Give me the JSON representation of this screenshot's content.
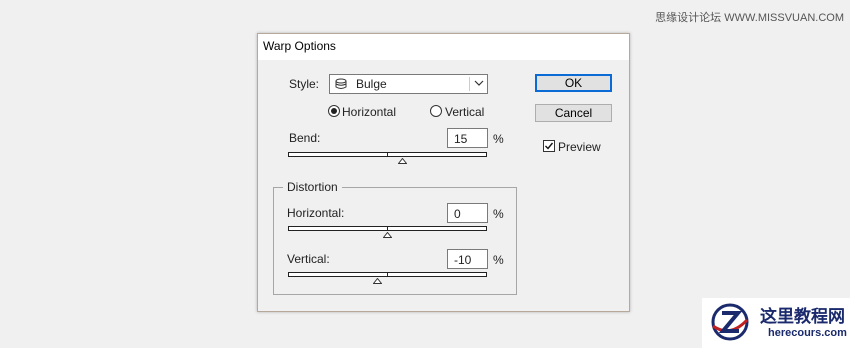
{
  "watermark": {
    "top_text": "思缘设计论坛 WWW.MISSVUAN.COM",
    "logo_cn": "这里教程网",
    "logo_url": "herecours.com"
  },
  "dialog": {
    "title": "Warp Options",
    "style": {
      "label": "Style:",
      "value": "Bulge",
      "icon": "bulge-icon"
    },
    "orientation": {
      "horizontal_label": "Horizontal",
      "vertical_label": "Vertical",
      "selected": "Horizontal"
    },
    "bend": {
      "label": "Bend:",
      "value": "15",
      "unit": "%",
      "slider_value": 15,
      "range": [
        -100,
        100
      ]
    },
    "distortion": {
      "title": "Distortion",
      "horizontal": {
        "label": "Horizontal:",
        "value": "0",
        "unit": "%",
        "slider_value": 0,
        "range": [
          -100,
          100
        ]
      },
      "vertical": {
        "label": "Vertical:",
        "value": "-10",
        "unit": "%",
        "slider_value": -10,
        "range": [
          -100,
          100
        ]
      }
    },
    "buttons": {
      "ok": "OK",
      "cancel": "Cancel"
    },
    "preview": {
      "label": "Preview",
      "checked": true
    },
    "colors": {
      "accent": "#0a6ad6",
      "border": "#b7a89c"
    }
  }
}
